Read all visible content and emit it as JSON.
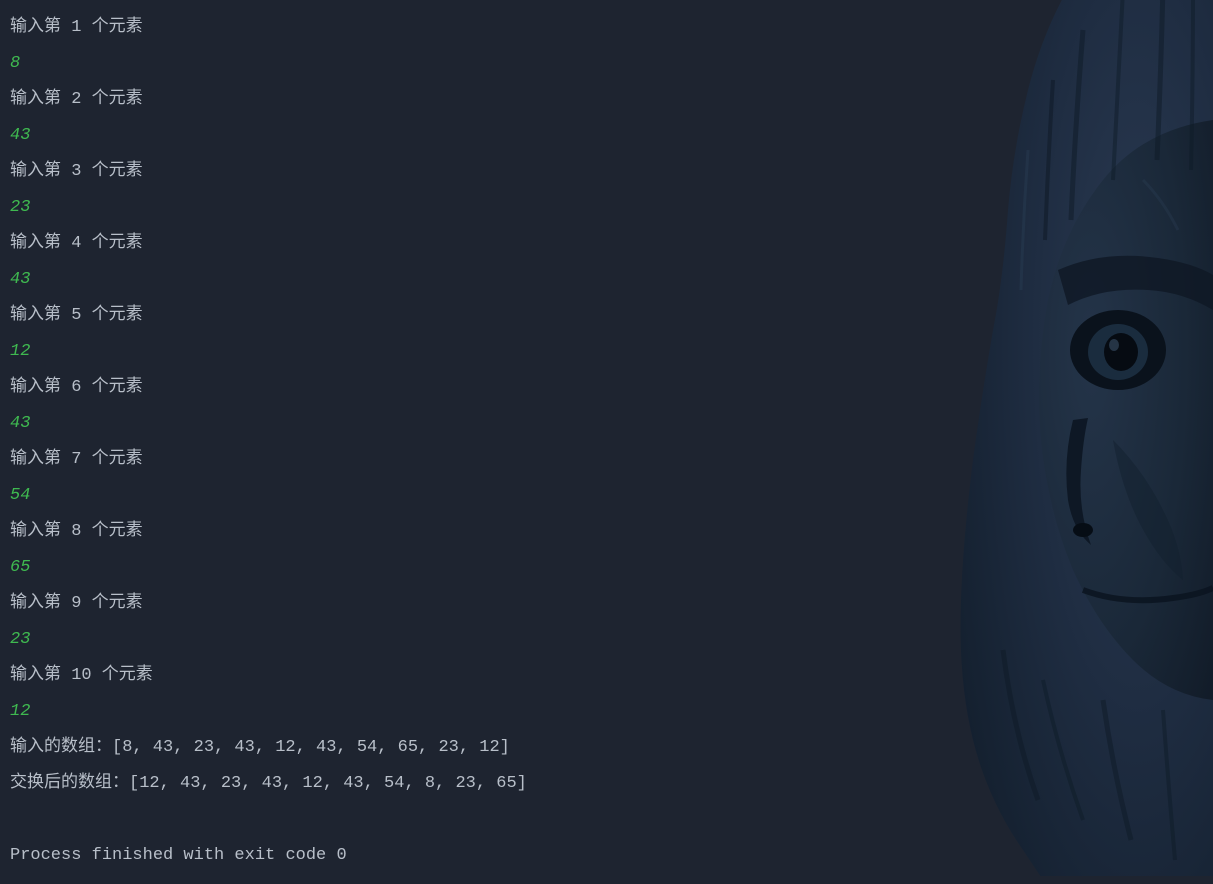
{
  "console": {
    "prompts": [
      {
        "label": "输入第 1 个元素",
        "value": "8"
      },
      {
        "label": "输入第 2 个元素",
        "value": "43"
      },
      {
        "label": "输入第 3 个元素",
        "value": "23"
      },
      {
        "label": "输入第 4 个元素",
        "value": "43"
      },
      {
        "label": "输入第 5 个元素",
        "value": "12"
      },
      {
        "label": "输入第 6 个元素",
        "value": "43"
      },
      {
        "label": "输入第 7 个元素",
        "value": "54"
      },
      {
        "label": "输入第 8 个元素",
        "value": "65"
      },
      {
        "label": "输入第 9 个元素",
        "value": "23"
      },
      {
        "label": "输入第 10 个元素",
        "value": "12"
      }
    ],
    "input_array_line": "输入的数组：[8, 43, 23, 43, 12, 43, 54, 65, 23, 12]",
    "swapped_array_line": "交换后的数组：[12, 43, 23, 43, 12, 43, 54, 8, 23, 65]",
    "exit_message": "Process finished with exit code 0"
  }
}
